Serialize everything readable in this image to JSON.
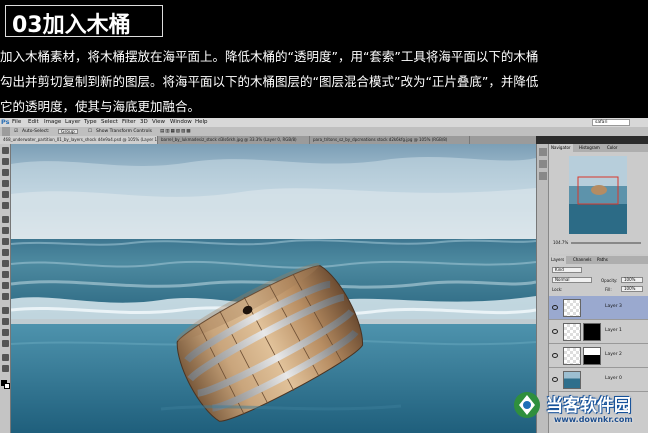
{
  "header": {
    "title": "03加入木桶",
    "lines": [
      "加入木桶素材，将木桶摆放在海平面上。降低木桶的“透明度”，用“套索”工具将海平面以下的木桶",
      "勾出并剪切复制到新的图层。将海平面以下的木桶图层的“图层混合模式”改为“正片叠底”，并降低",
      "它的透明度，使其与海底更加融合。"
    ]
  },
  "app": {
    "logo": "Ps",
    "menu": [
      "File",
      "Edit",
      "Image",
      "Layer",
      "Type",
      "Select",
      "Filter",
      "3D",
      "View",
      "Window",
      "Help"
    ],
    "search_value": "safari",
    "options": {
      "auto_select_label": "Auto-Select:",
      "auto_select_value": "Group",
      "transform_label": "Show Transform Controls"
    },
    "doc_tabs": [
      "468_underwater_partition_01_by_layers_shock d4e9a4.psd @ 105% (Layer 1, RGB/8)",
      "barrel_by_lukmadesiz_stock d3ls6rkh.jpg @ 33.3% (Layer 0, RGB/8)",
      "para_tritons_sz_by_dpcreations stock d2k6kfg.jpg @ 105% (RGB/8)"
    ],
    "icons": [
      "move-tool-icon",
      "marquee-tool-icon",
      "lasso-tool-icon",
      "quick-select-tool-icon",
      "crop-tool-icon",
      "eyedropper-tool-icon",
      "healing-brush-icon",
      "brush-tool-icon",
      "clone-stamp-icon",
      "history-brush-icon",
      "eraser-tool-icon",
      "gradient-tool-icon",
      "blur-tool-icon",
      "dodge-tool-icon",
      "pen-tool-icon",
      "type-tool-icon",
      "path-select-icon",
      "shape-tool-icon",
      "hand-tool-icon",
      "zoom-tool-icon"
    ]
  },
  "panels": {
    "navigator_tabs": [
      "Navigator",
      "Histogram",
      "Color"
    ],
    "zoom": "104.7%",
    "layers_tabs": [
      "Layers",
      "Channels",
      "Paths"
    ],
    "kind_label": "Kind",
    "blend_mode": "Normal",
    "opacity_label": "Opacity:",
    "opacity_value": "100%",
    "lock_label": "Lock:",
    "fill_label": "Fill:",
    "fill_value": "100%",
    "layers": [
      {
        "name": "Layer 3",
        "selected": true,
        "has_mask": false
      },
      {
        "name": "Layer 1",
        "selected": false,
        "has_mask": true
      },
      {
        "name": "Layer 2",
        "selected": false,
        "has_mask": true
      },
      {
        "name": "Layer 0",
        "selected": false,
        "has_mask": false
      }
    ]
  },
  "watermark": {
    "brand": "当客软件园",
    "url": "www.downkr.com"
  },
  "colors": {
    "menubar": "#d8d8d8",
    "selected_layer": "#9aa9cf",
    "sea": "#2f6f8c",
    "sky": "#a9c6d8"
  }
}
